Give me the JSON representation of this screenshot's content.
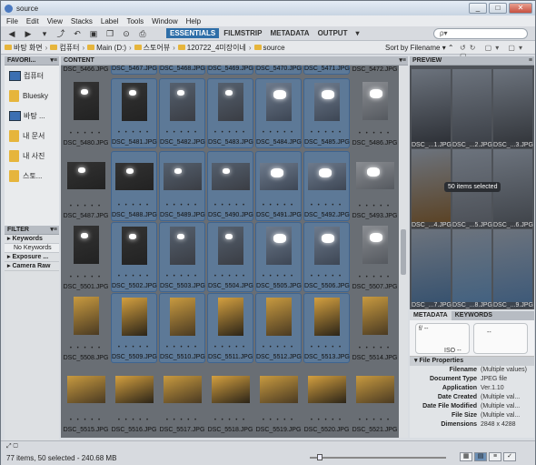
{
  "window": {
    "title": "source"
  },
  "menu": [
    "File",
    "Edit",
    "View",
    "Stacks",
    "Label",
    "Tools",
    "Window",
    "Help"
  ],
  "workspaces": {
    "items": [
      "ESSENTIALS",
      "FILMSTRIP",
      "METADATA",
      "OUTPUT"
    ],
    "active": "ESSENTIALS",
    "more": "▾"
  },
  "search": {
    "placeholder": "ρ▾"
  },
  "path": [
    "바탕 화면",
    "컴퓨터",
    "Main (D:)",
    "스토어뷰",
    "120722_4미장이네",
    "source"
  ],
  "sort": {
    "label": "Sort by Filename"
  },
  "panels": {
    "favorites": "FAVORI...",
    "filter": "FILTER",
    "content": "CONTENT",
    "preview": "PREVIEW",
    "metadata": "METADATA",
    "keywords": "KEYWORDS",
    "file_properties": "File Properties"
  },
  "favorites": [
    "컴퓨터",
    "Bluesky",
    "바탕 ...",
    "내 문서",
    "내 사진",
    "스토..."
  ],
  "filter": [
    {
      "label": "Keywords",
      "sub": false
    },
    {
      "label": "No Keywords",
      "sub": true
    },
    {
      "label": "Exposure ...",
      "sub": false
    },
    {
      "label": "Camera Raw",
      "sub": false
    }
  ],
  "files": [
    [
      "DSC_5466.JPG",
      "DSC_5467.JPG",
      "DSC_5468.JPG",
      "DSC_5469.JPG",
      "DSC_5470.JPG",
      "DSC_5471.JPG",
      "DSC_5472.JPG"
    ],
    [
      "DSC_5480.JPG",
      "DSC_5481.JPG",
      "DSC_5482.JPG",
      "DSC_5483.JPG",
      "DSC_5484.JPG",
      "DSC_5485.JPG",
      "DSC_5486.JPG"
    ],
    [
      "DSC_5487.JPG",
      "DSC_5488.JPG",
      "DSC_5489.JPG",
      "DSC_5490.JPG",
      "DSC_5491.JPG",
      "DSC_5492.JPG",
      "DSC_5493.JPG"
    ],
    [
      "DSC_5501.JPG",
      "DSC_5502.JPG",
      "DSC_5503.JPG",
      "DSC_5504.JPG",
      "DSC_5505.JPG",
      "DSC_5506.JPG",
      "DSC_5507.JPG"
    ],
    [
      "DSC_5508.JPG",
      "DSC_5509.JPG",
      "DSC_5510.JPG",
      "DSC_5511.JPG",
      "DSC_5512.JPG",
      "DSC_5513.JPG",
      "DSC_5514.JPG"
    ],
    [
      "DSC_5515.JPG",
      "DSC_5516.JPG",
      "DSC_5517.JPG",
      "DSC_5518.JPG",
      "DSC_5519.JPG",
      "DSC_5520.JPG",
      "DSC_5521.JPG"
    ]
  ],
  "preview_labels": [
    "DSC_...1.JPG",
    "DSC_...2.JPG",
    "DSC_...3.JPG",
    "DSC_...4.JPG",
    "DSC_...5.JPG",
    "DSC_...6.JPG",
    "DSC_...7.JPG",
    "DSC_...8.JPG",
    "DSC_...9.JPG"
  ],
  "preview_tooltip": "50 items selected",
  "metadata": {
    "camera": {
      "f": "f/ --",
      "iso": "ISO --",
      "dash": "--"
    },
    "props": [
      {
        "k": "Filename",
        "v": "(Multiple values)"
      },
      {
        "k": "Document Type",
        "v": "JPEG file"
      },
      {
        "k": "Application",
        "v": "Ver.1.10"
      },
      {
        "k": "Date Created",
        "v": "(Multiple val..."
      },
      {
        "k": "Date File Modified",
        "v": "(Multiple val..."
      },
      {
        "k": "File Size",
        "v": "(Multiple val..."
      },
      {
        "k": "Dimensions",
        "v": "2848 x 4288"
      }
    ]
  },
  "status": {
    "text": "77 items, 50 selected - 240.68 MB"
  }
}
